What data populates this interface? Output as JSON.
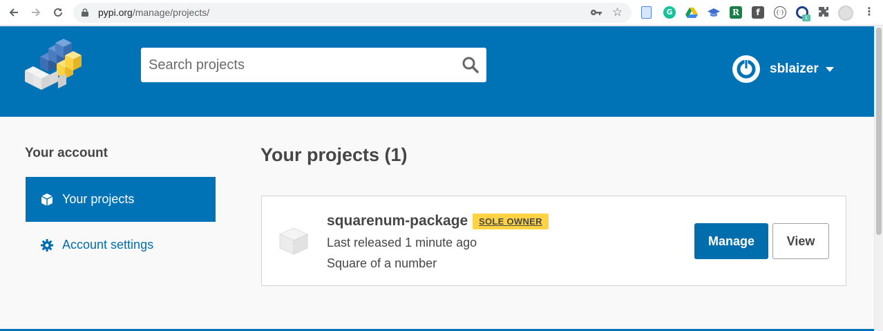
{
  "browser": {
    "url_host": "pypi.org",
    "url_path": "/manage/projects/",
    "extension_badge": "1"
  },
  "header": {
    "search_placeholder": "Search projects",
    "username": "sblaizer"
  },
  "sidebar": {
    "title": "Your account",
    "items": [
      {
        "label": "Your projects",
        "icon": "cube-icon",
        "active": true
      },
      {
        "label": "Account settings",
        "icon": "gear-icon",
        "active": false
      }
    ]
  },
  "main": {
    "title": "Your projects (1)",
    "projects": [
      {
        "name": "squarenum-package",
        "badge": "SOLE OWNER",
        "released": "Last released 1 minute ago",
        "description": "Square of a number",
        "manage_label": "Manage",
        "view_label": "View"
      }
    ]
  },
  "colors": {
    "brand_blue": "#0073b7",
    "badge_yellow": "#ffd343",
    "link_blue": "#006dad"
  }
}
